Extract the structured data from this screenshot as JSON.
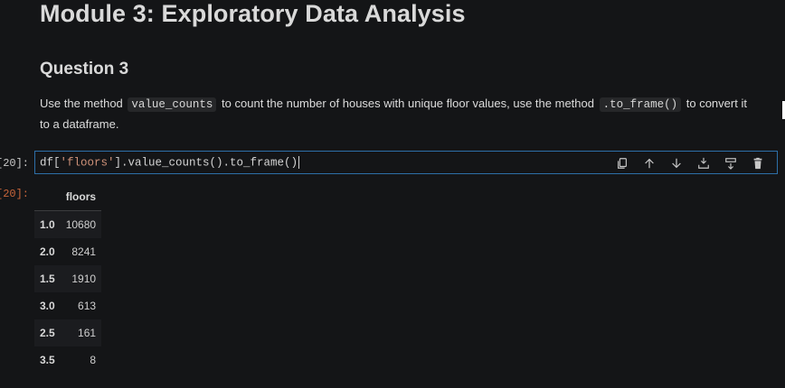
{
  "markdown": {
    "title": "Module 3: Exploratory Data Analysis",
    "subtitle": "Question 3",
    "para_part1": "Use the method",
    "code1": "value_counts",
    "para_part2": "to count the number of houses with unique floor values, use the method",
    "code2": ".to_frame()",
    "para_part3": "to convert it to a dataframe."
  },
  "cell": {
    "in_prompt": "[20]:",
    "out_prompt": "[20]:",
    "code_prefix": "df[",
    "code_string": "'floors'",
    "code_suffix": "].value_counts().to_frame()",
    "toolbar": [
      {
        "icon": "copy-icon"
      },
      {
        "icon": "arrow-up-icon"
      },
      {
        "icon": "arrow-down-icon"
      },
      {
        "icon": "insert-above-icon"
      },
      {
        "icon": "insert-below-icon"
      },
      {
        "icon": "trash-icon"
      }
    ]
  },
  "output": {
    "column_header": "floors",
    "rows": [
      {
        "index": "1.0",
        "value": "10680"
      },
      {
        "index": "2.0",
        "value": "8241"
      },
      {
        "index": "1.5",
        "value": "1910"
      },
      {
        "index": "3.0",
        "value": "613"
      },
      {
        "index": "2.5",
        "value": "161"
      },
      {
        "index": "3.5",
        "value": "8"
      }
    ]
  },
  "colors": {
    "background": "#141517",
    "cell_border": "#2d6fa8",
    "string_token": "#ce9178",
    "out_prompt": "#c8653a"
  }
}
